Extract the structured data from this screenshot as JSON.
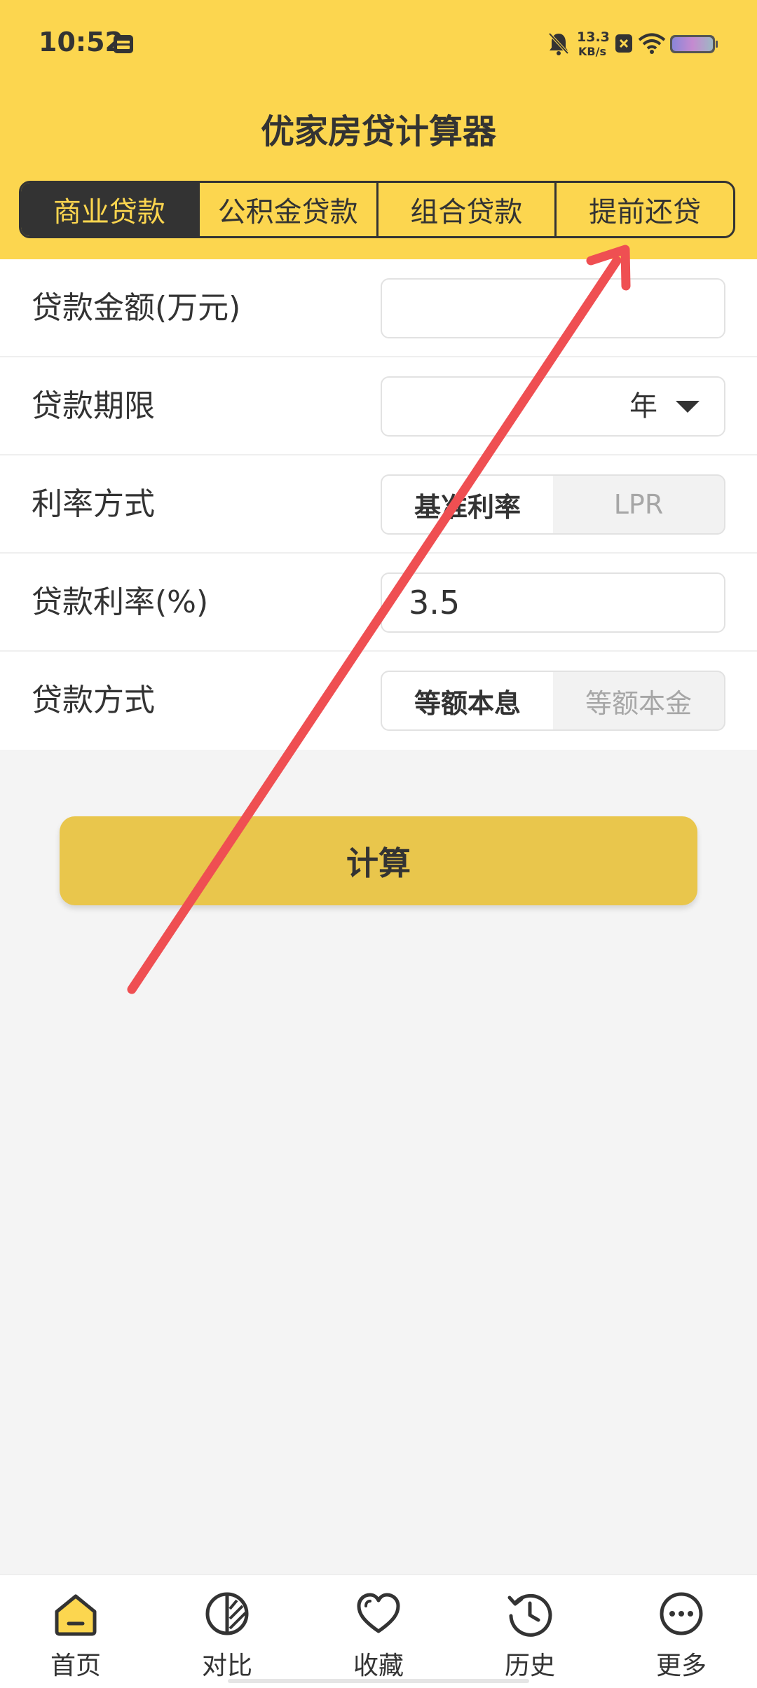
{
  "status_bar": {
    "time": "10:52",
    "net_speed_value": "13.3",
    "net_speed_unit": "KB/s"
  },
  "app_title": "优家房贷计算器",
  "tabs": [
    {
      "label": "商业贷款",
      "active": true
    },
    {
      "label": "公积金贷款",
      "active": false
    },
    {
      "label": "组合贷款",
      "active": false
    },
    {
      "label": "提前还贷",
      "active": false
    }
  ],
  "form": {
    "amount": {
      "label": "贷款金额(万元)",
      "value": ""
    },
    "term": {
      "label": "贷款期限",
      "value": "年"
    },
    "rate_mode": {
      "label": "利率方式",
      "options": [
        "基准利率",
        "LPR"
      ],
      "selected": "基准利率"
    },
    "rate": {
      "label": "贷款利率(%)",
      "value": "3.5"
    },
    "repay_method": {
      "label": "贷款方式",
      "options": [
        "等额本息",
        "等额本金"
      ],
      "selected": "等额本息"
    }
  },
  "calculate_label": "计算",
  "bottom_nav": [
    {
      "label": "首页",
      "icon": "home-icon",
      "active": true
    },
    {
      "label": "对比",
      "icon": "compare-icon"
    },
    {
      "label": "收藏",
      "icon": "heart-icon"
    },
    {
      "label": "历史",
      "icon": "history-icon"
    },
    {
      "label": "更多",
      "icon": "more-icon"
    }
  ],
  "colors": {
    "brand_yellow": "#fcd64f",
    "button_yellow": "#e9c64c",
    "dark": "#333333",
    "annotation_red": "#ef4f52"
  }
}
